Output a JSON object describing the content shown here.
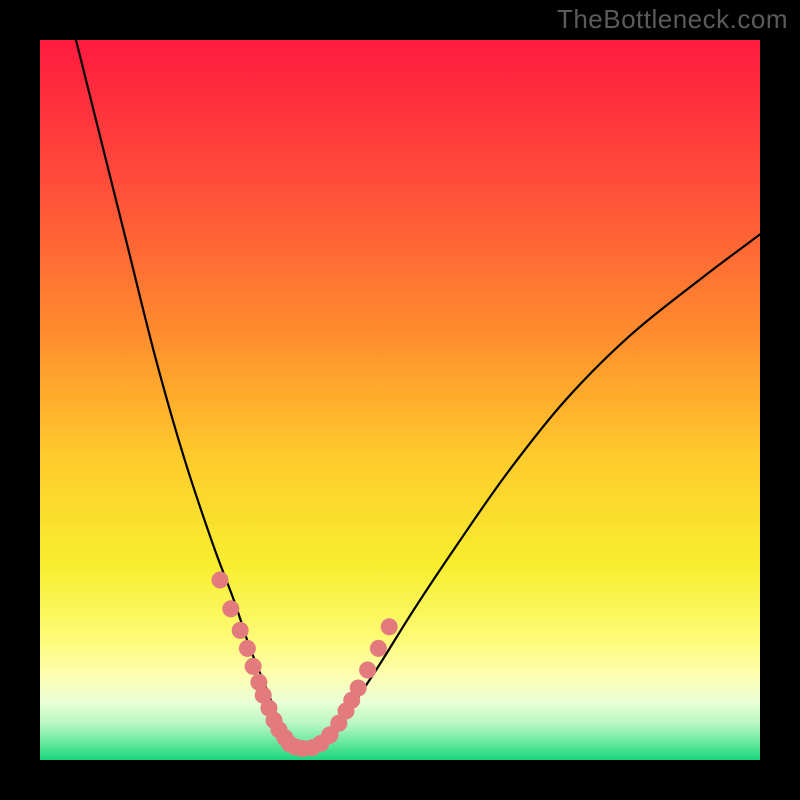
{
  "watermark": "TheBottleneck.com",
  "colors": {
    "frame": "#000000",
    "curve": "#000000",
    "bead": "#e27a7e",
    "gradient_stops": [
      {
        "offset": 0.0,
        "color": "#ff1a3e"
      },
      {
        "offset": 0.2,
        "color": "#ff4d3a"
      },
      {
        "offset": 0.4,
        "color": "#ff8a2e"
      },
      {
        "offset": 0.58,
        "color": "#ffcb2b"
      },
      {
        "offset": 0.73,
        "color": "#f7ee2f"
      },
      {
        "offset": 0.83,
        "color": "#fdfb74"
      },
      {
        "offset": 0.88,
        "color": "#fffdad"
      },
      {
        "offset": 0.92,
        "color": "#eaffd6"
      },
      {
        "offset": 0.95,
        "color": "#b7f7c3"
      },
      {
        "offset": 0.975,
        "color": "#6be9a0"
      },
      {
        "offset": 1.0,
        "color": "#19d67e"
      }
    ]
  },
  "chart_data": {
    "type": "line",
    "title": "",
    "xlabel": "",
    "ylabel": "",
    "xlim": [
      0,
      100
    ],
    "ylim": [
      0,
      100
    ],
    "series": [
      {
        "name": "bottleneck-curve",
        "x": [
          5,
          8,
          12,
          16,
          20,
          24,
          27,
          29,
          31,
          33,
          34.5,
          36,
          38,
          40,
          43,
          47,
          52,
          58,
          65,
          73,
          82,
          92,
          100
        ],
        "y": [
          100,
          88,
          72,
          56,
          42,
          30,
          22,
          16,
          11,
          6,
          3,
          1.5,
          1.5,
          3,
          7,
          13,
          21,
          30,
          40,
          50,
          59,
          67,
          73
        ]
      }
    ],
    "beads": {
      "name": "highlight-beads",
      "x": [
        25,
        26.5,
        27.8,
        28.8,
        29.6,
        30.4,
        31,
        31.8,
        32.5,
        33.2,
        34,
        34.7,
        35.5,
        36.5,
        37.8,
        39,
        40.2,
        40.3,
        41.5,
        42.5,
        43.3,
        44.2,
        45.5,
        47,
        48.5
      ],
      "y": [
        25,
        21,
        18,
        15.5,
        13,
        10.8,
        9,
        7.2,
        5.5,
        4.2,
        3.1,
        2.2,
        1.8,
        1.6,
        1.7,
        2.3,
        3.4,
        3.5,
        5.1,
        6.8,
        8.3,
        10,
        12.5,
        15.5,
        18.5
      ]
    }
  }
}
